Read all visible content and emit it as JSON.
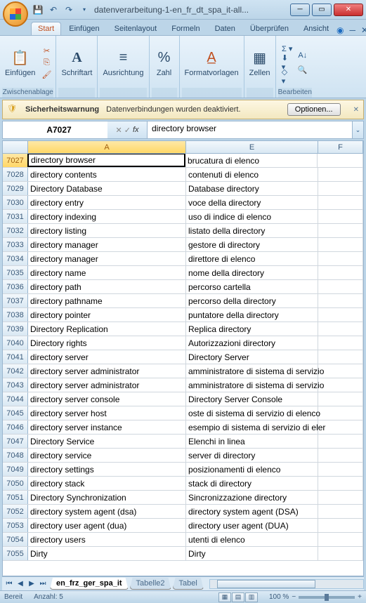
{
  "window": {
    "title": "datenverarbeitung-1-en_fr_dt_spa_it-all..."
  },
  "tabs": {
    "items": [
      "Start",
      "Einfügen",
      "Seitenlayout",
      "Formeln",
      "Daten",
      "Überprüfen",
      "Ansicht"
    ],
    "active": 0
  },
  "ribbon": {
    "clipboard": {
      "paste": "Einfügen",
      "label": "Zwischenablage"
    },
    "font": {
      "label": "Schriftart"
    },
    "align": {
      "label": "Ausrichtung"
    },
    "number": {
      "label": "Zahl"
    },
    "styles": {
      "label": "Formatvorlagen"
    },
    "cells": {
      "label": "Zellen"
    },
    "editing": {
      "label": "Bearbeiten"
    }
  },
  "warning": {
    "title": "Sicherheitswarnung",
    "msg": "Datenverbindungen wurden deaktiviert.",
    "button": "Optionen..."
  },
  "namebox": "A7027",
  "formula": "directory browser",
  "columns": {
    "a": "A",
    "e": "E",
    "f": "F"
  },
  "rows": [
    {
      "n": 7027,
      "a": "directory browser",
      "e": "brucatura di elenco"
    },
    {
      "n": 7028,
      "a": "directory contents",
      "e": "contenuti di elenco"
    },
    {
      "n": 7029,
      "a": "Directory Database",
      "e": "Database directory"
    },
    {
      "n": 7030,
      "a": "directory entry",
      "e": "voce della directory"
    },
    {
      "n": 7031,
      "a": "directory indexing",
      "e": "uso di indice di elenco"
    },
    {
      "n": 7032,
      "a": "directory listing",
      "e": "listato della directory"
    },
    {
      "n": 7033,
      "a": "directory manager",
      "e": "gestore di directory"
    },
    {
      "n": 7034,
      "a": "directory manager",
      "e": "direttore di elenco"
    },
    {
      "n": 7035,
      "a": "directory name",
      "e": "nome della directory"
    },
    {
      "n": 7036,
      "a": "directory path",
      "e": "percorso cartella"
    },
    {
      "n": 7037,
      "a": "directory pathname",
      "e": "percorso della directory"
    },
    {
      "n": 7038,
      "a": "directory pointer",
      "e": "puntatore della directory"
    },
    {
      "n": 7039,
      "a": "Directory Replication",
      "e": "Replica directory"
    },
    {
      "n": 7040,
      "a": "Directory rights",
      "e": "Autorizzazioni directory"
    },
    {
      "n": 7041,
      "a": "directory server",
      "e": "Directory Server"
    },
    {
      "n": 7042,
      "a": "directory server administrator",
      "e": "amministratore di sistema di servizio"
    },
    {
      "n": 7043,
      "a": "directory server administrator",
      "e": "amministratore di sistema di servizio"
    },
    {
      "n": 7044,
      "a": "directory server console",
      "e": "Directory Server Console"
    },
    {
      "n": 7045,
      "a": "directory server host",
      "e": "oste di sistema di servizio di elenco"
    },
    {
      "n": 7046,
      "a": "directory server instance",
      "e": "esempio di sistema di servizio di eler"
    },
    {
      "n": 7047,
      "a": "Directory Service",
      "e": "Elenchi in linea"
    },
    {
      "n": 7048,
      "a": "directory service",
      "e": "server di directory"
    },
    {
      "n": 7049,
      "a": "directory settings",
      "e": "posizionamenti di elenco"
    },
    {
      "n": 7050,
      "a": "directory stack",
      "e": "stack di directory"
    },
    {
      "n": 7051,
      "a": "Directory Synchronization",
      "e": "Sincronizzazione directory"
    },
    {
      "n": 7052,
      "a": "directory system agent (dsa)",
      "e": "directory system agent (DSA)"
    },
    {
      "n": 7053,
      "a": "directory user agent (dua)",
      "e": "directory user agent (DUA)"
    },
    {
      "n": 7054,
      "a": "directory users",
      "e": "utenti di elenco"
    },
    {
      "n": 7055,
      "a": "Dirty",
      "e": "Dirty"
    }
  ],
  "sheets": {
    "active": "en_frz_ger_spa_it",
    "others": [
      "Tabelle2",
      "Tabel"
    ]
  },
  "status": {
    "ready": "Bereit",
    "count_label": "Anzahl: 5",
    "zoom": "100 %"
  }
}
